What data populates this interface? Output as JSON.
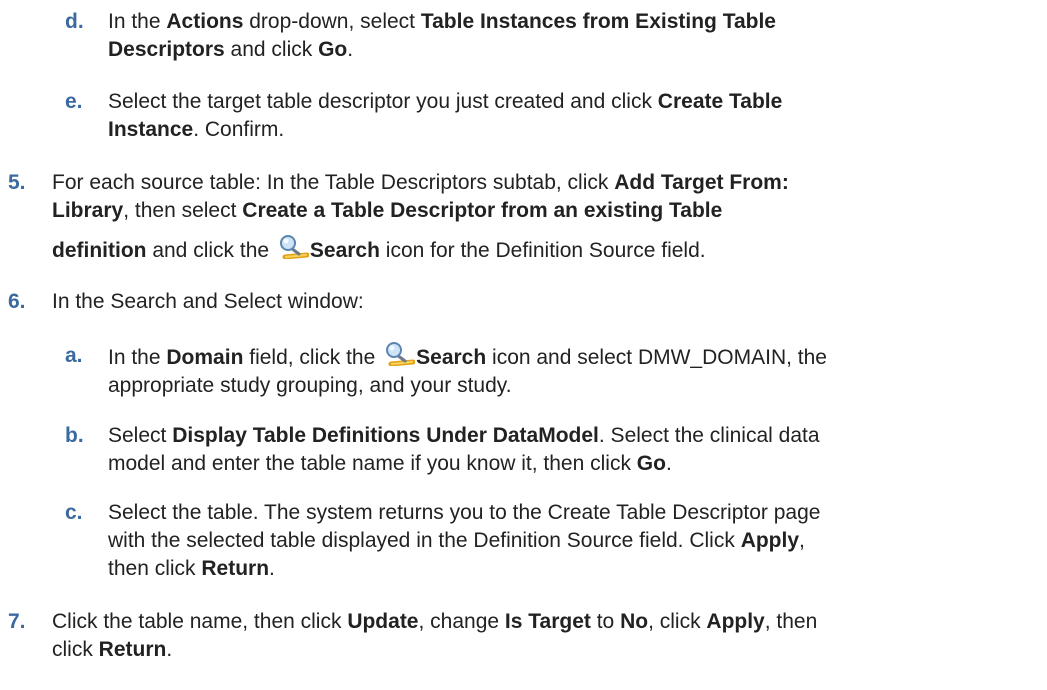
{
  "colors": {
    "marker": "#3b6aa0",
    "text": "#222222"
  },
  "icons": {
    "search": "search-icon"
  },
  "steps": {
    "d": {
      "marker": "d.",
      "t1": "In the ",
      "b1": "Actions",
      "t2": " drop-down, select ",
      "b2": "Table Instances from Existing Table",
      "b3": "Descriptors",
      "t3": " and click ",
      "b4": "Go",
      "t4": "."
    },
    "e": {
      "marker": "e.",
      "t1": "Select the target table descriptor you just created and click ",
      "b1": "Create Table",
      "b2": "Instance",
      "t2": ". Confirm."
    },
    "s5": {
      "marker": "5.",
      "t1": "For each source table: In the Table Descriptors subtab, click ",
      "b1": "Add Target From:",
      "b2": "Library",
      "t2": ", then select ",
      "b3": "Create a Table Descriptor from an existing Table",
      "b4": "definition",
      "t3": " and click the ",
      "b5": "Search",
      "t4": " icon for the Definition Source field."
    },
    "s6": {
      "marker": "6.",
      "t1": "In the Search and Select window:"
    },
    "a": {
      "marker": "a.",
      "t1": "In the ",
      "b1": "Domain",
      "t2": " field, click the ",
      "b2": "Search",
      "t3": " icon and select DMW_DOMAIN, the",
      "t4": "appropriate study grouping, and your study."
    },
    "b": {
      "marker": "b.",
      "t1": "Select ",
      "b1": "Display Table Definitions Under DataModel",
      "t2": ". Select the clinical data",
      "t3": "model and enter the table name if you know it, then click ",
      "b2": "Go",
      "t4": "."
    },
    "c": {
      "marker": "c.",
      "t1": "Select the table. The system returns you to the Create Table Descriptor page",
      "t2": "with the selected table displayed in the Definition Source field. Click ",
      "b1": "Apply",
      "t3": ",",
      "t4": "then click ",
      "b2": "Return",
      "t5": "."
    },
    "s7": {
      "marker": "7.",
      "t1": "Click the table name, then click ",
      "b1": "Update",
      "t2": ", change ",
      "b2": "Is Target",
      "t3": " to ",
      "b3": "No",
      "t4": ", click ",
      "b4": "Apply",
      "t5": ", then",
      "t6": "click ",
      "b5": "Return",
      "t7": "."
    }
  }
}
